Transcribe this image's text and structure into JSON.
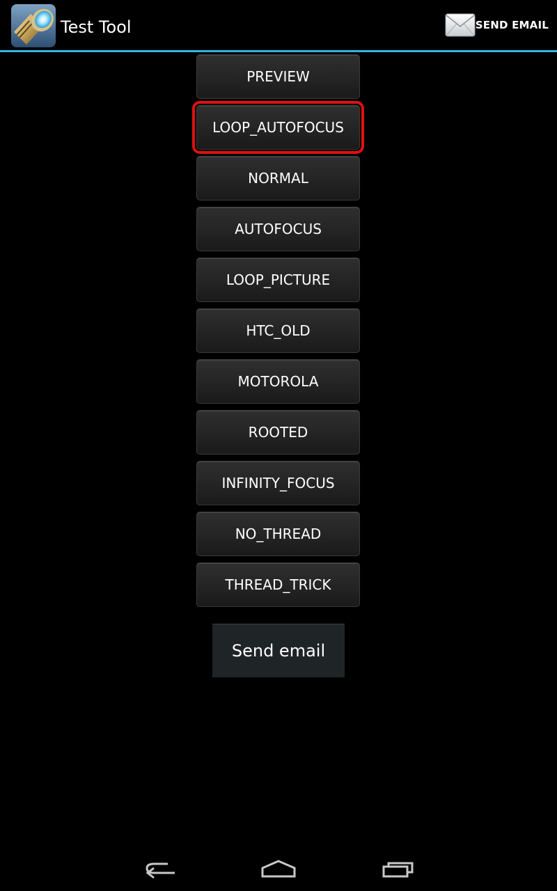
{
  "action_bar": {
    "title": "Test Tool",
    "app_icon": "flashlight-icon",
    "send_email_action": {
      "label": "SEND EMAIL",
      "icon": "envelope-icon"
    },
    "divider_color": "#33b5e5"
  },
  "modes": [
    {
      "label": "PREVIEW",
      "highlighted": false
    },
    {
      "label": "LOOP_AUTOFOCUS",
      "highlighted": true
    },
    {
      "label": "NORMAL",
      "highlighted": false
    },
    {
      "label": "AUTOFOCUS",
      "highlighted": false
    },
    {
      "label": "LOOP_PICTURE",
      "highlighted": false
    },
    {
      "label": "HTC_OLD",
      "highlighted": false
    },
    {
      "label": "MOTOROLA",
      "highlighted": false
    },
    {
      "label": "ROOTED",
      "highlighted": false
    },
    {
      "label": "INFINITY_FOCUS",
      "highlighted": false
    },
    {
      "label": "NO_THREAD",
      "highlighted": false
    },
    {
      "label": "THREAD_TRICK",
      "highlighted": false
    }
  ],
  "send_email_button": {
    "label": "Send email"
  },
  "nav_bar": {
    "back_icon": "back-icon",
    "home_icon": "home-icon",
    "recents_icon": "recents-icon"
  },
  "highlight_color": "#e01010"
}
